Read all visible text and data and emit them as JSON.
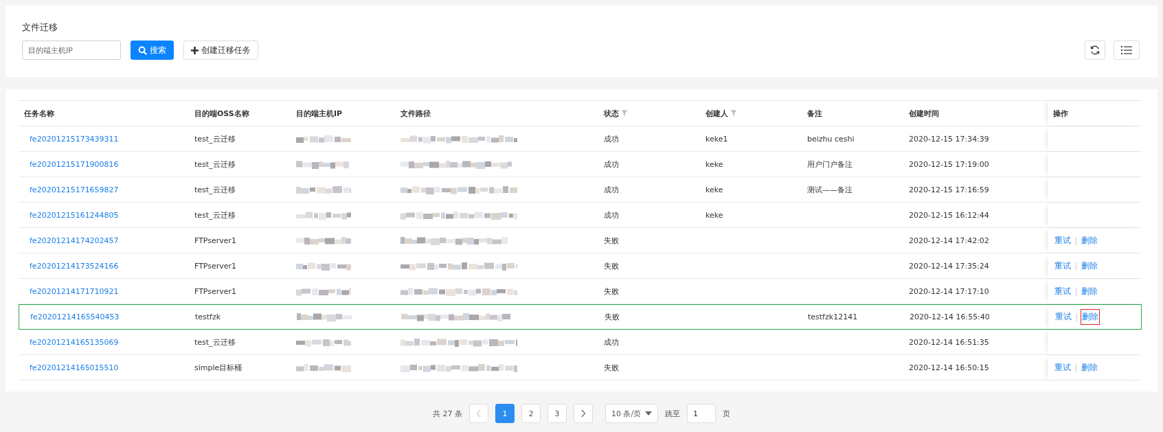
{
  "page_title": "文件迁移",
  "search": {
    "placeholder": "目的端主机IP",
    "button": "搜索"
  },
  "create_button": "创建迁移任务",
  "table": {
    "columns": [
      {
        "label": "任务名称",
        "filterable": false
      },
      {
        "label": "目的端OSS名称",
        "filterable": false
      },
      {
        "label": "目的端主机IP",
        "filterable": false
      },
      {
        "label": "文件路径",
        "filterable": false
      },
      {
        "label": "状态",
        "filterable": true
      },
      {
        "label": "创建人",
        "filterable": true
      },
      {
        "label": "备注",
        "filterable": false
      },
      {
        "label": "创建时间",
        "filterable": false
      },
      {
        "label": "操作",
        "filterable": false
      }
    ],
    "rows": [
      {
        "task": "fe20201215173439311",
        "oss": "test_云迁移",
        "status": "成功",
        "creator": "keke1",
        "note": "beizhu ceshi",
        "time": "2020-12-15 17:34:39",
        "selected": false
      },
      {
        "task": "fe20201215171900816",
        "oss": "test_云迁移",
        "status": "成功",
        "creator": "keke",
        "note": "用户门户备注",
        "time": "2020-12-15 17:19:00",
        "selected": false
      },
      {
        "task": "fe20201215171659827",
        "oss": "test_云迁移",
        "status": "成功",
        "creator": "keke",
        "note": "测试——备注",
        "time": "2020-12-15 17:16:59",
        "selected": false
      },
      {
        "task": "fe20201215161244805",
        "oss": "test_云迁移",
        "status": "成功",
        "creator": "keke",
        "time": "2020-12-15 16:12:44",
        "selected": false
      },
      {
        "task": "fe20201214174202457",
        "oss": "FTPserver1",
        "status": "失败",
        "time": "2020-12-14 17:42:02",
        "selected": false,
        "actions": [
          {
            "label": "重试",
            "outlined": false
          },
          {
            "label": "删除",
            "outlined": false
          }
        ]
      },
      {
        "task": "fe20201214173524166",
        "oss": "FTPserver1",
        "status": "失败",
        "time": "2020-12-14 17:35:24",
        "selected": false,
        "actions": [
          {
            "label": "重试",
            "outlined": false
          },
          {
            "label": "删除",
            "outlined": false
          }
        ]
      },
      {
        "task": "fe20201214171710921",
        "oss": "FTPserver1",
        "status": "失败",
        "time": "2020-12-14 17:17:10",
        "selected": false,
        "actions": [
          {
            "label": "重试",
            "outlined": false
          },
          {
            "label": "删除",
            "outlined": false
          }
        ]
      },
      {
        "task": "fe20201214165540453",
        "oss": "testfzk",
        "status": "失败",
        "note": "testfzk12141",
        "time": "2020-12-14 16:55:40",
        "selected": true,
        "actions": [
          {
            "label": "重试",
            "outlined": false
          },
          {
            "label": "删除",
            "outlined": true
          }
        ]
      },
      {
        "task": "fe20201214165135069",
        "oss": "test_云迁移",
        "status": "成功",
        "time": "2020-12-14 16:51:35",
        "selected": false
      },
      {
        "task": "fe20201214165015510",
        "oss": "simple目标桶",
        "status": "失败",
        "time": "2020-12-14 16:50:15",
        "selected": false,
        "actions": [
          {
            "label": "重试",
            "outlined": false
          },
          {
            "label": "删除",
            "outlined": false
          }
        ]
      }
    ]
  },
  "pagination": {
    "total": "共 27 条",
    "pages": [
      {
        "label": "1",
        "selected": true
      },
      {
        "label": "2",
        "selected": false
      },
      {
        "label": "3",
        "selected": false
      }
    ],
    "page_size": "10 条/页",
    "jump_label": "跳至",
    "jump_value": "1",
    "page_suffix": "页"
  }
}
